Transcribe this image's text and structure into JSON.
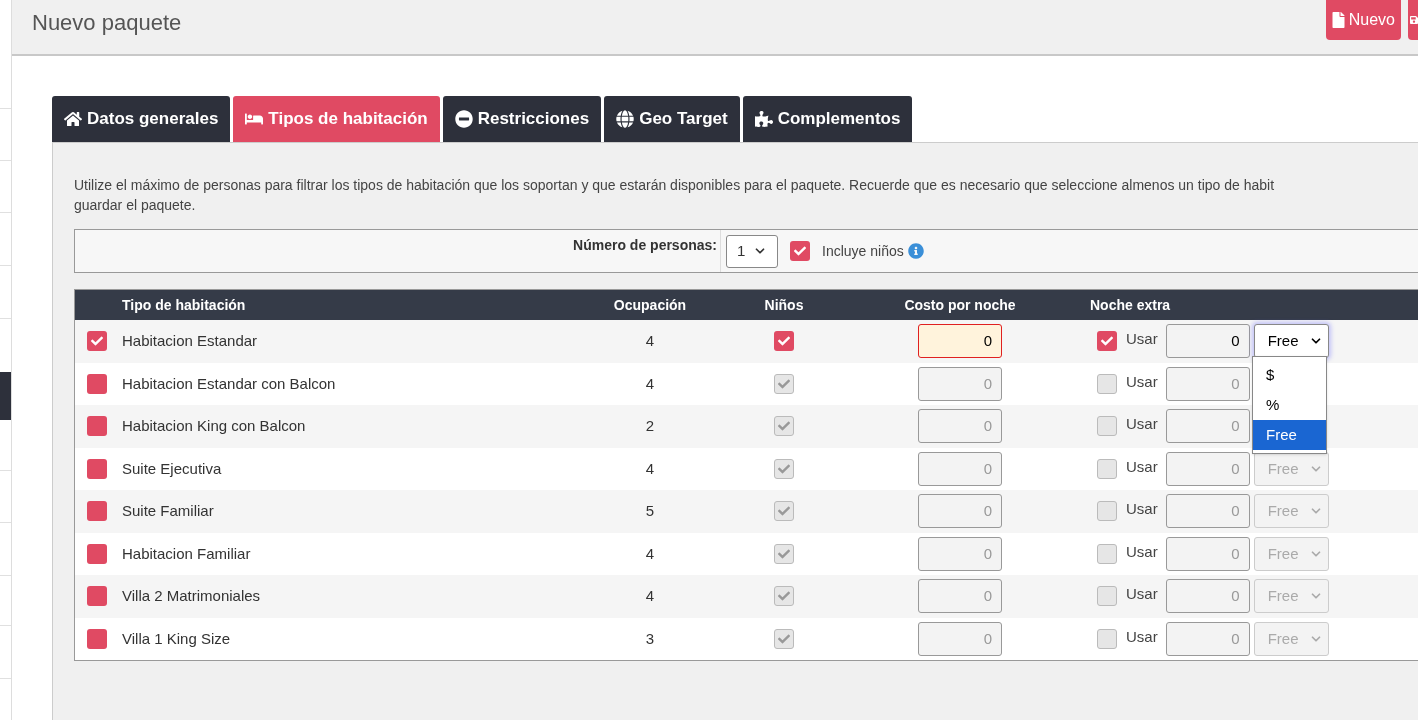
{
  "header": {
    "title": "Nuevo paquete",
    "buttons": [
      {
        "label": "Nuevo"
      }
    ]
  },
  "tabs": [
    {
      "label": "Datos generales",
      "selected": false
    },
    {
      "label": "Tipos de habitación",
      "selected": true
    },
    {
      "label": "Restricciones",
      "selected": false
    },
    {
      "label": "Geo Target",
      "selected": false
    },
    {
      "label": "Complementos",
      "selected": false
    }
  ],
  "description": "Utilize el máximo de personas para filtrar los tipos de habitación que los soportan y que estarán disponibles para el paquete. Recuerde que es necesario que seleccione almenos un tipo de habit\nguardar el paquete.",
  "filter": {
    "label": "Número de personas:",
    "persons": "1",
    "children": {
      "label": "Incluye niños",
      "checked": true
    }
  },
  "table": {
    "columns": [
      "Tipo de habitación",
      "Ocupación",
      "Niños",
      "Costo por noche",
      "Noche extra"
    ],
    "rows": [
      {
        "selected": true,
        "name": "Habitacion Estandar",
        "occupancy": "4",
        "children": true,
        "cost": "0",
        "invalid": true,
        "extra": true,
        "extra_label": "Usar",
        "extra_value": "0",
        "unit": "Free",
        "unit_focused": true
      },
      {
        "selected": false,
        "name": "Habitacion Estandar con Balcon",
        "occupancy": "4",
        "children": true,
        "cost": "0",
        "invalid": false,
        "extra": false,
        "extra_label": "Usar",
        "extra_value": "0"
      },
      {
        "selected": false,
        "name": "Habitacion King con Balcon",
        "occupancy": "2",
        "children": true,
        "cost": "0",
        "invalid": false,
        "extra": false,
        "extra_label": "Usar",
        "extra_value": "0"
      },
      {
        "selected": false,
        "name": "Suite Ejecutiva",
        "occupancy": "4",
        "children": true,
        "cost": "0",
        "invalid": false,
        "extra": false,
        "extra_label": "Usar",
        "extra_value": "0",
        "unit": "Free",
        "unit_focused": false
      },
      {
        "selected": false,
        "name": "Suite Familiar",
        "occupancy": "5",
        "children": true,
        "cost": "0",
        "invalid": false,
        "extra": false,
        "extra_label": "Usar",
        "extra_value": "0",
        "unit": "Free",
        "unit_focused": false
      },
      {
        "selected": false,
        "name": "Habitacion Familiar",
        "occupancy": "4",
        "children": true,
        "cost": "0",
        "invalid": false,
        "extra": false,
        "extra_label": "Usar",
        "extra_value": "0",
        "unit": "Free",
        "unit_focused": false
      },
      {
        "selected": false,
        "name": "Villa 2 Matrimoniales",
        "occupancy": "4",
        "children": true,
        "cost": "0",
        "invalid": false,
        "extra": false,
        "extra_label": "Usar",
        "extra_value": "0",
        "unit": "Free",
        "unit_focused": false
      },
      {
        "selected": false,
        "name": "Villa 1 King Size",
        "occupancy": "3",
        "children": true,
        "cost": "0",
        "invalid": false,
        "extra": false,
        "extra_label": "Usar",
        "extra_value": "0",
        "unit": "Free",
        "unit_focused": false
      }
    ]
  },
  "unit_menu": {
    "options": [
      {
        "label": "$",
        "selected": false
      },
      {
        "label": "%",
        "selected": false
      },
      {
        "label": "Free",
        "selected": true
      }
    ]
  }
}
